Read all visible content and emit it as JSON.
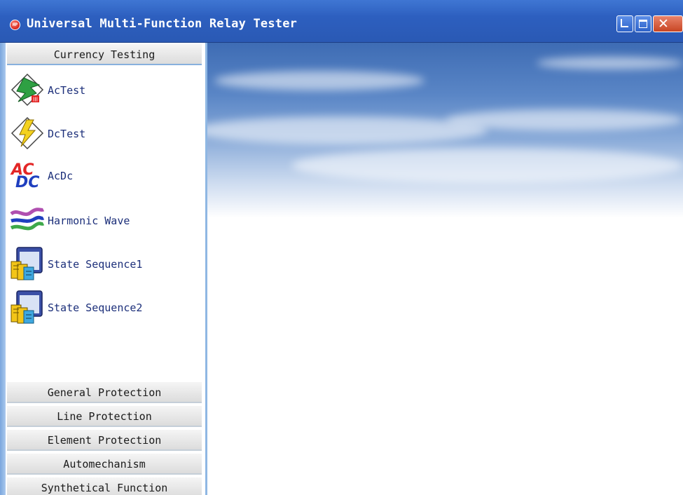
{
  "window": {
    "title": "Universal Multi-Function Relay Tester",
    "app_icon": "app-logo-icon",
    "app_icon_text": "HP",
    "title_color": "#2d5fbf"
  },
  "sidebar": {
    "active_group": {
      "label": "Currency Testing",
      "items": [
        {
          "label": "AcTest",
          "icon": "actest-icon"
        },
        {
          "label": "DcTest",
          "icon": "dctest-icon"
        },
        {
          "label": "AcDc",
          "icon": "acdc-icon",
          "icon_text_top": "AC",
          "icon_text_bottom": "DC"
        },
        {
          "label": "Harmonic Wave",
          "icon": "harmonic-wave-icon"
        },
        {
          "label": "State Sequence1",
          "icon": "state-sequence-icon"
        },
        {
          "label": "State Sequence2",
          "icon": "state-sequence-icon"
        }
      ]
    },
    "groups": [
      {
        "label": "General Protection"
      },
      {
        "label": "Line Protection"
      },
      {
        "label": "Element Protection"
      },
      {
        "label": "Automechanism"
      },
      {
        "label": "Synthetical Function"
      }
    ]
  },
  "colors": {
    "item_text": "#1c2f7a",
    "sidebar_border": "#8fb7e3",
    "sky": "#5a86c6"
  }
}
